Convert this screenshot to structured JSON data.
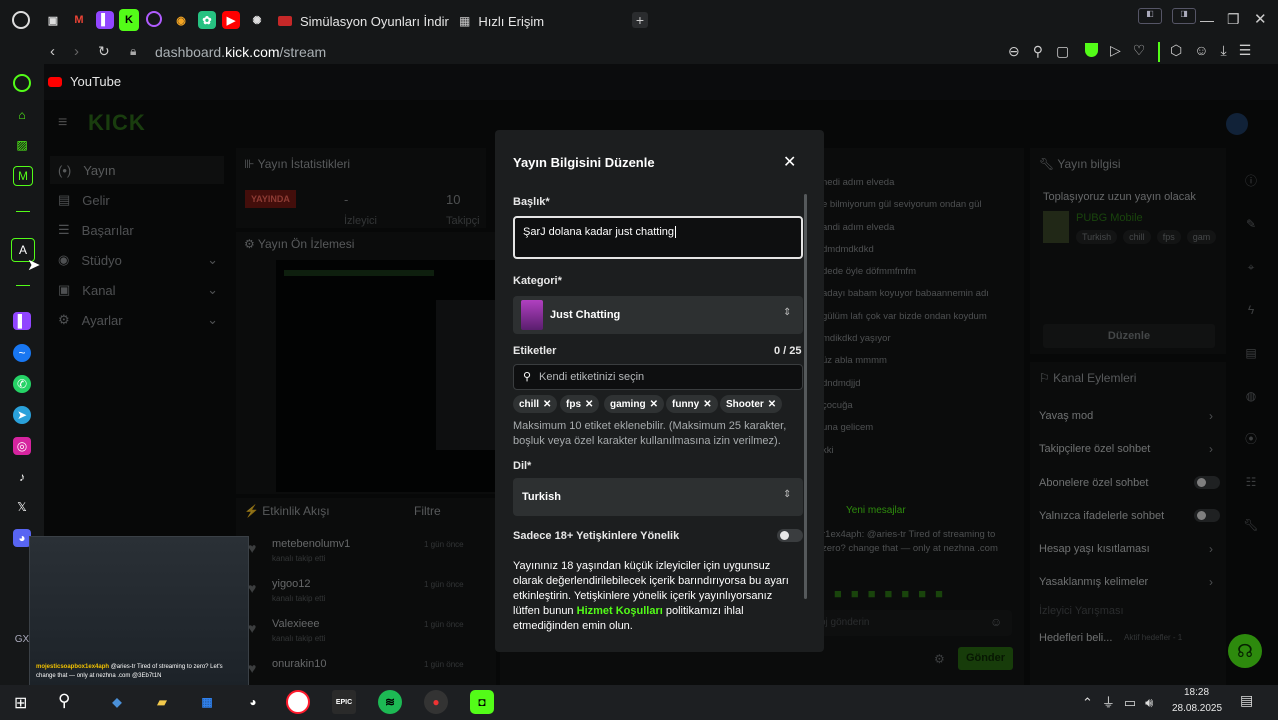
{
  "browser": {
    "tabs": [
      {
        "label": "Simülasyon Oyunları İndir"
      },
      {
        "label": "Hızlı Erişim"
      }
    ],
    "address": {
      "prefix": "dashboard.",
      "domain": "kick.com",
      "path": "/stream"
    },
    "bookmark": "YouTube"
  },
  "kick": {
    "logo": "KICK",
    "nav": [
      "Yayın",
      "Gelir",
      "Başarılar",
      "Stüdyo",
      "Kanal",
      "Ayarlar"
    ],
    "stats_title": "Yayın İstatistikleri",
    "live_badge": "YAYINDA",
    "stats": [
      {
        "value": "-",
        "label": "İzleyici"
      },
      {
        "value": "10",
        "label": "Takipçi"
      }
    ],
    "preview_title": "Yayın Ön İzlemesi",
    "activity_title": "Etkinlik Akışı",
    "filter_label": "Filtre",
    "activity": [
      {
        "name": "metebenolumv1",
        "sub": "kanalı takip etti",
        "time": "1 gün önce"
      },
      {
        "name": "yigoo12",
        "sub": "kanalı takip etti",
        "time": "1 gün önce"
      },
      {
        "name": "Valexieee",
        "sub": "kanalı takip etti",
        "time": "1 gün önce"
      },
      {
        "name": "onurakin10",
        "sub": "",
        "time": "1 gün önce"
      }
    ],
    "chat_lines": [
      "nedi adım elveda",
      "e bilmiyorum gül seviyorum ondan gül",
      "andi adım elveda",
      "dmdmdkdkd",
      "dede öyle döfmmfmfm",
      "adayı babam koyuyor babaannemin adı",
      "gülüm lafı çok var bizde ondan koydum",
      "mdikdkd yaşıyor",
      "üz abla mmmm",
      "dndmdjjd",
      "çocuğa",
      "una gelicem",
      "kki"
    ],
    "new_messages": "Yeni mesajlar",
    "chat_last": "r1ex4aph: @aries-tr Tired of streaming to zero? change that — only at nezhna .com",
    "chat_input": "oj gönderin",
    "send_button": "Gönder",
    "stream_info_title": "Yayın bilgisi",
    "stream_info_text": "Toplaşıyoruz uzun yayın olacak",
    "stream_game": "PUBG Mobile",
    "stream_tags": [
      "Turkish",
      "chill",
      "fps",
      "gam"
    ],
    "edit_button": "Düzenle",
    "channel_actions_title": "Kanal Eylemleri",
    "channel_actions": [
      "Yavaş mod",
      "Takipçilere özel sohbet",
      "Abonelere özel sohbet",
      "Yalnızca ifadelerle sohbet",
      "Hesap yaşı kısıtlaması",
      "Yasaklanmış kelimeler",
      "İzleyici Yarışması",
      "Hedefleri beli..."
    ],
    "goals_status": "Aktif hedefler - 1"
  },
  "modal": {
    "title": "Yayın Bilgisini Düzenle",
    "title_label": "Başlık*",
    "title_value": "ŞarJ dolana kadar just chatting",
    "category_label": "Kategori*",
    "category_value": "Just Chatting",
    "tags_label": "Etiketler",
    "tags_count": "0 / 25",
    "tags_placeholder": "Kendi etiketinizi seçin",
    "tags": [
      "chill",
      "fps",
      "gaming",
      "funny",
      "Shooter"
    ],
    "tags_help": "Maksimum 10 etiket eklenebilir. (Maksimum 25 karakter, boşluk veya özel karakter kullanılmasına izin verilmez).",
    "language_label": "Dil*",
    "language_value": "Turkish",
    "adult_label": "Sadece 18+ Yetişkinlere Yönelik",
    "adult_text_1": "Yayınınız 18 yaşından küçük izleyiciler için uygunsuz olarak değerlendirilebilecek içerik barındırıyorsa bu ayarı etkinleştirin. Yetişkinlere yönelik içerik yayınlıyorsanız lütfen bunun ",
    "adult_link": "Hizmet Koşulları",
    "adult_text_2": " politikamızı ihlal etmediğinden emin olun."
  },
  "overlay_chat": {
    "user": "mojesticsoapbox1ex4aph",
    "text": "@aries-tr Tired of streaming to zero? Let's change that — only at nezhna .com @3Eb7t1N"
  },
  "taskbar": {
    "time": "18:28",
    "date": "28.08.2025"
  },
  "colors": {
    "kick_green": "#53fc18",
    "badge_red": "#c0392b"
  },
  "icons": [
    "opera-icon",
    "search-icon",
    "youtube-icon",
    "kick-icon",
    "close-icon",
    "chevron-right-icon"
  ]
}
